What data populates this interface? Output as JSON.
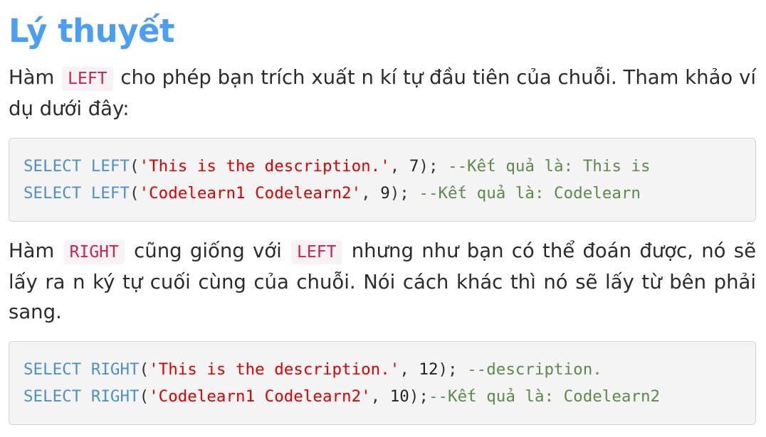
{
  "title": "Lý thuyết",
  "para1": {
    "before": "Hàm",
    "code": "LEFT",
    "after": "cho phép bạn trích xuất n kí tự đầu tiên của chuỗi. Tham khảo ví dụ dưới đây:"
  },
  "block1": {
    "lines": [
      {
        "kw1": "SELECT",
        "fn": "LEFT",
        "open": "(",
        "str": "'This is the description.'",
        "sep": ", ",
        "num": "7",
        "close": ");",
        "space": " ",
        "cmt": "--Kết quả là: This is"
      },
      {
        "kw1": "SELECT",
        "fn": "LEFT",
        "open": "(",
        "str": "'Codelearn1 Codelearn2'",
        "sep": ", ",
        "num": "9",
        "close": ");",
        "space": " ",
        "cmt": "--Kết quả là: Codelearn"
      }
    ]
  },
  "para2": {
    "before": "Hàm",
    "code1": "RIGHT",
    "middle": "cũng giống với",
    "code2": "LEFT",
    "after": "nhưng như bạn có thể đoán được, nó sẽ lấy ra n ký tự cuối cùng của chuỗi. Nói cách khác thì nó sẽ lấy từ bên phải sang."
  },
  "block2": {
    "lines": [
      {
        "kw1": "SELECT",
        "fn": "RIGHT",
        "open": "(",
        "str": "'This is the description.'",
        "sep": ", ",
        "num": "12",
        "close": ");",
        "space": " ",
        "cmt": "--description."
      },
      {
        "kw1": "SELECT",
        "fn": "RIGHT",
        "open": "(",
        "str": "'Codelearn1 Codelearn2'",
        "sep": ", ",
        "num": "10",
        "close": ");",
        "space": "",
        "cmt": "--Kết quả là: Codelearn2"
      }
    ]
  }
}
